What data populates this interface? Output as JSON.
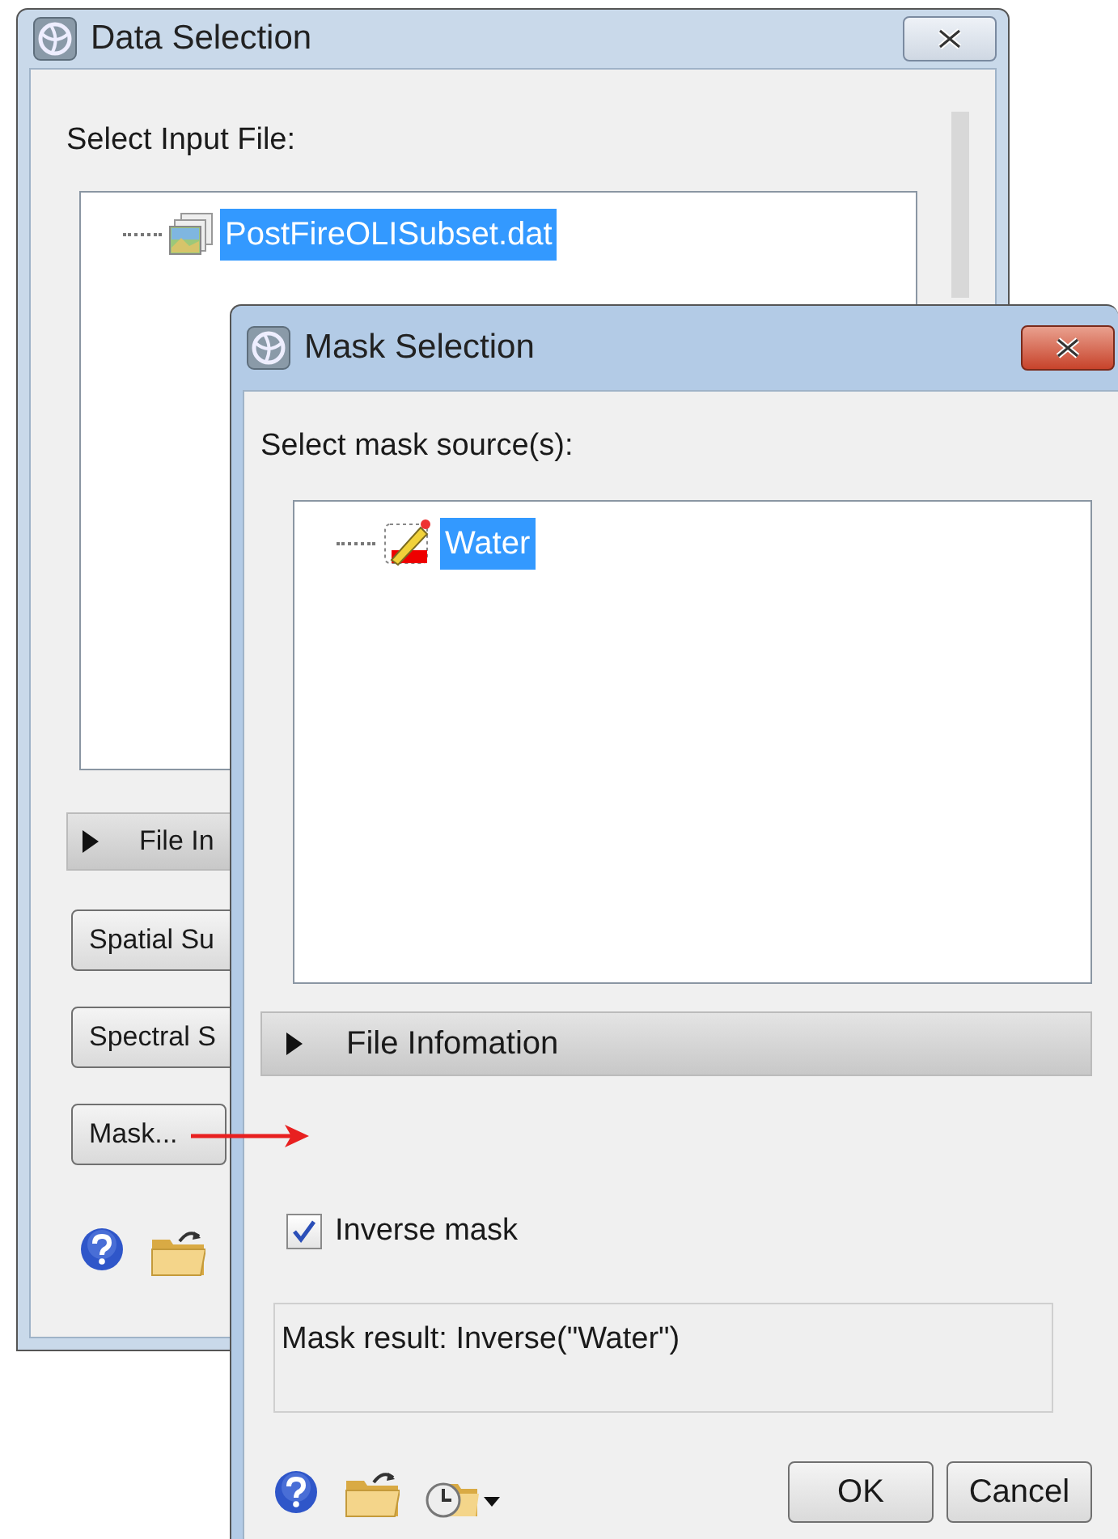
{
  "data_selection": {
    "title": "Data Selection",
    "active": false,
    "prompt": "Select Input File:",
    "tree": [
      {
        "label": "PostFireOLISubset.dat",
        "selected": true
      }
    ],
    "expander": {
      "label": "File In",
      "expanded": false
    },
    "buttons": [
      "Spatial Su",
      "Spectral S",
      "Mask..."
    ]
  },
  "mask_selection": {
    "title": "Mask Selection",
    "active": true,
    "prompt": "Select mask source(s):",
    "tree": [
      {
        "label": "Water",
        "selected": true
      }
    ],
    "expander": {
      "label": "File Infomation",
      "expanded": false
    },
    "inverse_mask": {
      "label": "Inverse mask",
      "checked": true
    },
    "result": "Mask result: Inverse(\"Water\")",
    "buttons": [
      "OK",
      "Cancel"
    ]
  }
}
